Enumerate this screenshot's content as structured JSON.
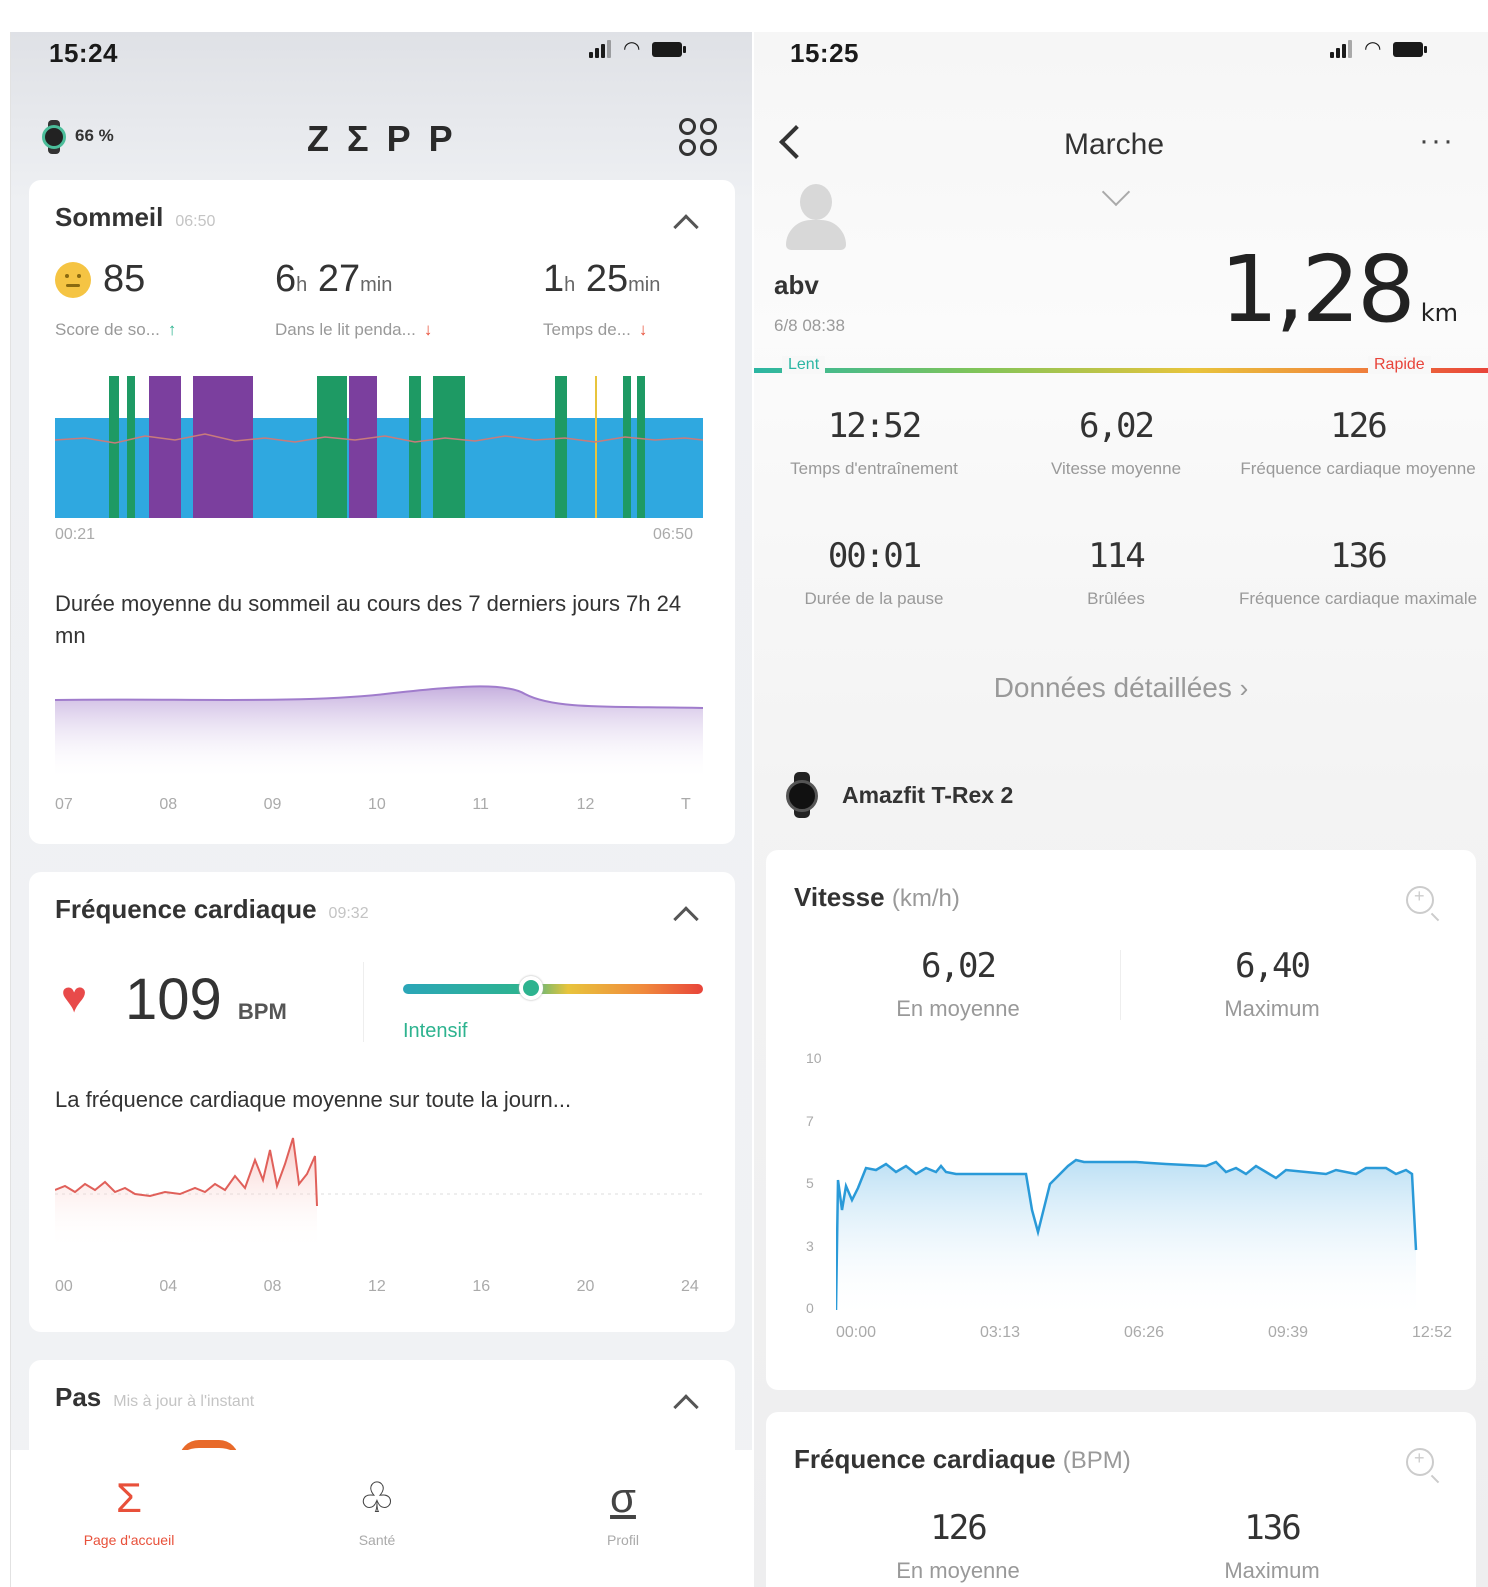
{
  "left": {
    "status": {
      "time": "15:24"
    },
    "header": {
      "battery": "66 %",
      "logo": "ZΣPP",
      "menu_icon": "grid-icon"
    },
    "sleep": {
      "title": "Sommeil",
      "time": "06:50",
      "score": "85",
      "score_label": "Score de so...",
      "in_bed_h": "6",
      "in_bed_m": "27",
      "in_bed_label": "Dans le lit penda...",
      "other_h": "1",
      "other_m": "25",
      "other_label": "Temps de...",
      "unit_h": "h",
      "unit_min": "min",
      "chart_start": "00:21",
      "chart_end": "06:50",
      "average_text": "Durée moyenne du sommeil au cours des 7 derniers jours 7h 24 mn",
      "week_ticks": [
        "07",
        "08",
        "09",
        "10",
        "11",
        "12",
        "T"
      ],
      "colors": {
        "light": "#2fa8e0",
        "deep": "#7b3f9e",
        "rem": "#1e9a64",
        "awake": "#e8c43c"
      }
    },
    "heart": {
      "title": "Fréquence cardiaque",
      "time": "09:32",
      "bpm": "109",
      "bpm_unit": "BPM",
      "zone_label": "Intensif",
      "avg_text": "La fréquence cardiaque moyenne sur toute la journ...",
      "ticks": [
        "00",
        "04",
        "08",
        "12",
        "16",
        "20",
        "24"
      ]
    },
    "steps": {
      "title": "Pas",
      "updated": "Mis à jour à l'instant"
    },
    "nav": [
      {
        "glyph": "Σ",
        "label": "Page d'accueil",
        "active": true
      },
      {
        "glyph": "♧",
        "label": "Santé",
        "active": false
      },
      {
        "glyph": "σ",
        "label": "Profil",
        "active": false
      }
    ]
  },
  "right": {
    "status": {
      "time": "15:25"
    },
    "header": {
      "title": "Marche",
      "more": "···"
    },
    "user": {
      "name": "abv",
      "date": "6/8 08:38"
    },
    "distance": {
      "value": "1,28",
      "unit": "km"
    },
    "pace": {
      "slow": "Lent",
      "fast": "Rapide"
    },
    "stats": [
      {
        "value": "12:52",
        "label": "Temps d'entraînement"
      },
      {
        "value": "6,02",
        "label": "Vitesse moyenne"
      },
      {
        "value": "126",
        "label": "Fréquence cardiaque moyenne"
      },
      {
        "value": "00:01",
        "label": "Durée de la pause"
      },
      {
        "value": "114",
        "label": "Brûlées"
      },
      {
        "value": "136",
        "label": "Fréquence cardiaque maximale"
      }
    ],
    "detail_link": "Données détaillées",
    "device": "Amazfit T-Rex 2",
    "speed": {
      "title": "Vitesse",
      "unit": "(km/h)",
      "avg": "6,02",
      "avg_label": "En moyenne",
      "max": "6,40",
      "max_label": "Maximum",
      "y_ticks": [
        "10",
        "7",
        "5",
        "3",
        "0"
      ],
      "x_ticks": [
        "00:00",
        "03:13",
        "06:26",
        "09:39",
        "12:52"
      ]
    },
    "heart": {
      "title": "Fréquence cardiaque",
      "unit": "(BPM)",
      "avg": "126",
      "avg_label": "En moyenne",
      "max": "136",
      "max_label": "Maximum"
    }
  },
  "accent": "#e8503a",
  "teal": "#2db38f"
}
